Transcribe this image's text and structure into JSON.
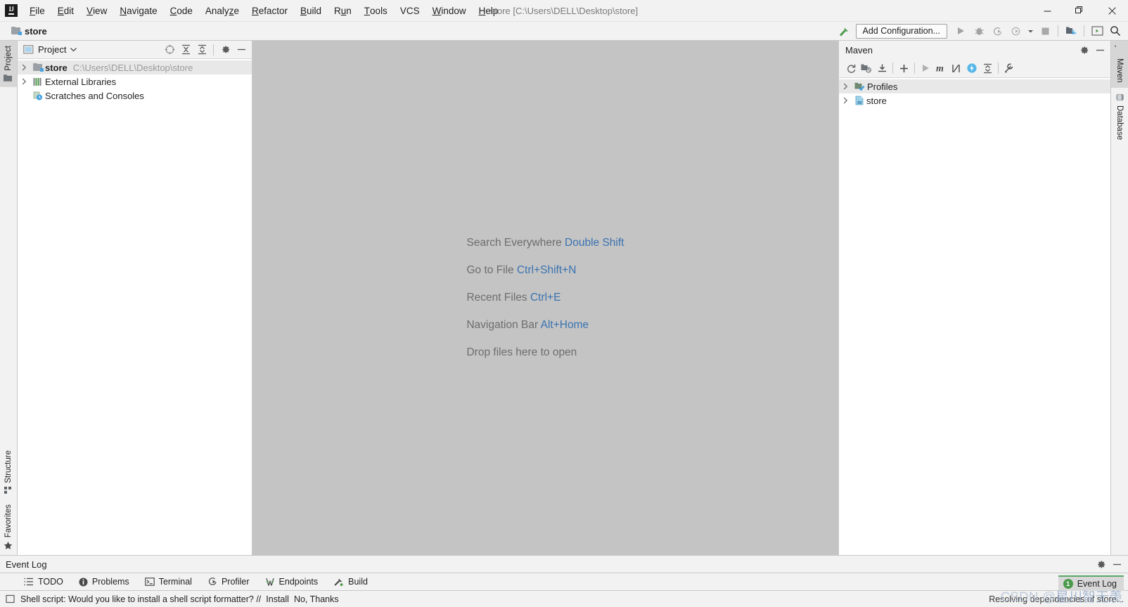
{
  "window": {
    "title": "store [C:\\Users\\DELL\\Desktop\\store]",
    "minimize_label": "Minimize",
    "restore_label": "Restore",
    "close_label": "Close"
  },
  "menu": {
    "items": [
      {
        "label": "File",
        "mnemonic": "F"
      },
      {
        "label": "Edit",
        "mnemonic": "E"
      },
      {
        "label": "View",
        "mnemonic": "V"
      },
      {
        "label": "Navigate",
        "mnemonic": "N"
      },
      {
        "label": "Code",
        "mnemonic": "C"
      },
      {
        "label": "Analyze",
        "mnemonic": "z"
      },
      {
        "label": "Refactor",
        "mnemonic": "R"
      },
      {
        "label": "Build",
        "mnemonic": "B"
      },
      {
        "label": "Run",
        "mnemonic": "u"
      },
      {
        "label": "Tools",
        "mnemonic": "T"
      },
      {
        "label": "VCS",
        "mnemonic": ""
      },
      {
        "label": "Window",
        "mnemonic": "W"
      },
      {
        "label": "Help",
        "mnemonic": "H"
      }
    ]
  },
  "navbar": {
    "breadcrumb": "store",
    "breadcrumb_icon": "folder-module-icon",
    "add_configuration_label": "Add Configuration...",
    "buttons": [
      {
        "name": "build-hammer-icon",
        "label": "Build"
      },
      {
        "name": "run-icon",
        "label": "Run"
      },
      {
        "name": "debug-icon",
        "label": "Debug"
      },
      {
        "name": "run-with-coverage-icon",
        "label": "Run with Coverage"
      },
      {
        "name": "profile-icon",
        "label": "Profile"
      },
      {
        "name": "dropdown-chevron-icon",
        "label": "More"
      },
      {
        "name": "stop-icon",
        "label": "Stop"
      },
      {
        "name": "git-icon",
        "label": "Version Control"
      },
      {
        "name": "terminal-window-icon",
        "label": "Terminal"
      },
      {
        "name": "search-everywhere-icon",
        "label": "Search Everywhere"
      }
    ]
  },
  "left_stripe": {
    "top": [
      {
        "label": "Project",
        "icon": "project-folder-icon",
        "active": true
      }
    ],
    "bottom": [
      {
        "label": "Structure",
        "icon": "structure-icon",
        "active": false
      },
      {
        "label": "Favorites",
        "icon": "star-icon",
        "active": false
      }
    ]
  },
  "right_stripe": {
    "top": [
      {
        "label": "Maven",
        "icon": "maven-m-icon",
        "active": true
      },
      {
        "label": "Database",
        "icon": "database-icon",
        "active": false
      }
    ]
  },
  "project_panel": {
    "title": "Project",
    "view_icon": "project-view-icon",
    "chevron": "▾",
    "actions": [
      {
        "name": "select-opened-file-icon",
        "label": "Select Opened File"
      },
      {
        "name": "expand-all-icon",
        "label": "Expand All"
      },
      {
        "name": "collapse-all-icon",
        "label": "Collapse All"
      },
      {
        "name": "settings-gear-icon",
        "label": "Options"
      },
      {
        "name": "hide-icon",
        "label": "Hide"
      }
    ],
    "tree": [
      {
        "name": "store",
        "path": "C:\\Users\\DELL\\Desktop\\store",
        "icon": "module-folder-icon",
        "expandable": true,
        "bold": true,
        "selected": true,
        "indent": 0
      },
      {
        "name": "External Libraries",
        "path": "",
        "icon": "libraries-icon",
        "expandable": true,
        "bold": false,
        "selected": false,
        "indent": 0
      },
      {
        "name": "Scratches and Consoles",
        "path": "",
        "icon": "scratches-icon",
        "expandable": false,
        "bold": false,
        "selected": false,
        "indent": 0
      }
    ]
  },
  "editor": {
    "tips": [
      {
        "text": "Search Everywhere ",
        "shortcut": "Double Shift"
      },
      {
        "text": "Go to File ",
        "shortcut": "Ctrl+Shift+N"
      },
      {
        "text": "Recent Files ",
        "shortcut": "Ctrl+E"
      },
      {
        "text": "Navigation Bar ",
        "shortcut": "Alt+Home"
      },
      {
        "text": "Drop files here to open",
        "shortcut": ""
      }
    ]
  },
  "maven_panel": {
    "title": "Maven",
    "actions": [
      {
        "name": "settings-gear-icon",
        "label": "Maven Settings"
      },
      {
        "name": "hide-icon",
        "label": "Hide"
      }
    ],
    "toolbar": [
      {
        "name": "reload-projects-icon",
        "label": "Reload All Maven Projects"
      },
      {
        "name": "generate-sources-icon",
        "label": "Generate Sources and Update Folders"
      },
      {
        "name": "download-sources-icon",
        "label": "Download Sources and/or Documentation"
      },
      {
        "name": "add-maven-project-icon",
        "label": "Add Maven Projects"
      },
      {
        "name": "run-maven-build-icon",
        "label": "Run Maven Build"
      },
      {
        "name": "execute-maven-goal-icon",
        "label": "Execute Maven Goal"
      },
      {
        "name": "toggle-skip-tests-icon",
        "label": "Toggle Skip Tests Mode"
      },
      {
        "name": "toggle-offline-icon",
        "label": "Toggle Offline Mode"
      },
      {
        "name": "collapse-all-icon",
        "label": "Collapse All"
      },
      {
        "name": "maven-settings-wrench-icon",
        "label": "Maven Settings"
      }
    ],
    "tree": [
      {
        "name": "Profiles",
        "icon": "profiles-icon",
        "expandable": true,
        "selected": true
      },
      {
        "name": "store",
        "icon": "maven-project-icon",
        "expandable": true,
        "selected": false
      }
    ]
  },
  "event_log_panel": {
    "title": "Event Log",
    "actions": [
      {
        "name": "settings-gear-icon",
        "label": "Settings"
      },
      {
        "name": "hide-icon",
        "label": "Hide"
      }
    ]
  },
  "bottom_bar": {
    "tabs": [
      {
        "label": "TODO",
        "icon": "todo-list-icon"
      },
      {
        "label": "Problems",
        "icon": "problems-icon"
      },
      {
        "label": "Terminal",
        "icon": "terminal-icon"
      },
      {
        "label": "Profiler",
        "icon": "profiler-icon"
      },
      {
        "label": "Endpoints",
        "icon": "endpoints-icon"
      },
      {
        "label": "Build",
        "icon": "build-hammer-icon"
      }
    ]
  },
  "status_bar": {
    "icon": "notification-balloon-icon",
    "message": "Shell script: Would you like to install a shell script formatter? //",
    "actions": [
      {
        "label": "Install"
      },
      {
        "label": "No, Thanks"
      }
    ],
    "progress_text": "Resolving dependencies of store...",
    "event_log_chip": {
      "label": "Event Log",
      "count": "1"
    }
  },
  "watermark": {
    "prefix": "CSDN @",
    "text": "星川智无羡"
  },
  "colors": {
    "accent_blue": "#3a72b0",
    "editor_bg": "#c4c4c4",
    "panel_bg": "#f2f2f2",
    "green": "#59a869",
    "maven_blue": "#56b6e7"
  }
}
